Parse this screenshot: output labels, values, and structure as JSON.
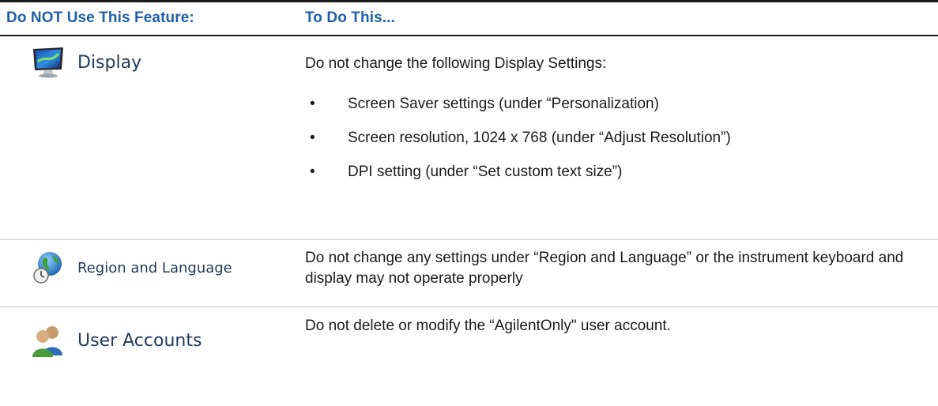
{
  "header": {
    "col1": "Do NOT Use This Feature:",
    "col2": "To Do This..."
  },
  "rows": [
    {
      "feature_label": "Display",
      "feature_icon": "monitor-icon",
      "intro": "Do not change the following Display Settings:",
      "bullets": [
        "Screen Saver settings (under “Personalization)",
        "Screen resolution, 1024 x 768 (under “Adjust Resolution”)",
        "DPI setting (under “Set custom text size”)"
      ]
    },
    {
      "feature_label": "Region and Language",
      "feature_icon": "globe-clock-icon",
      "description": "Do not change any settings under “Region and Language” or the instrument keyboard and display may not operate properly"
    },
    {
      "feature_label": "User Accounts",
      "feature_icon": "users-icon",
      "description": "Do not delete or modify the “AgilentOnly\" user account."
    }
  ],
  "colors": {
    "header_text": "#1f5fa8",
    "feature_label": "#1e3a5c"
  }
}
